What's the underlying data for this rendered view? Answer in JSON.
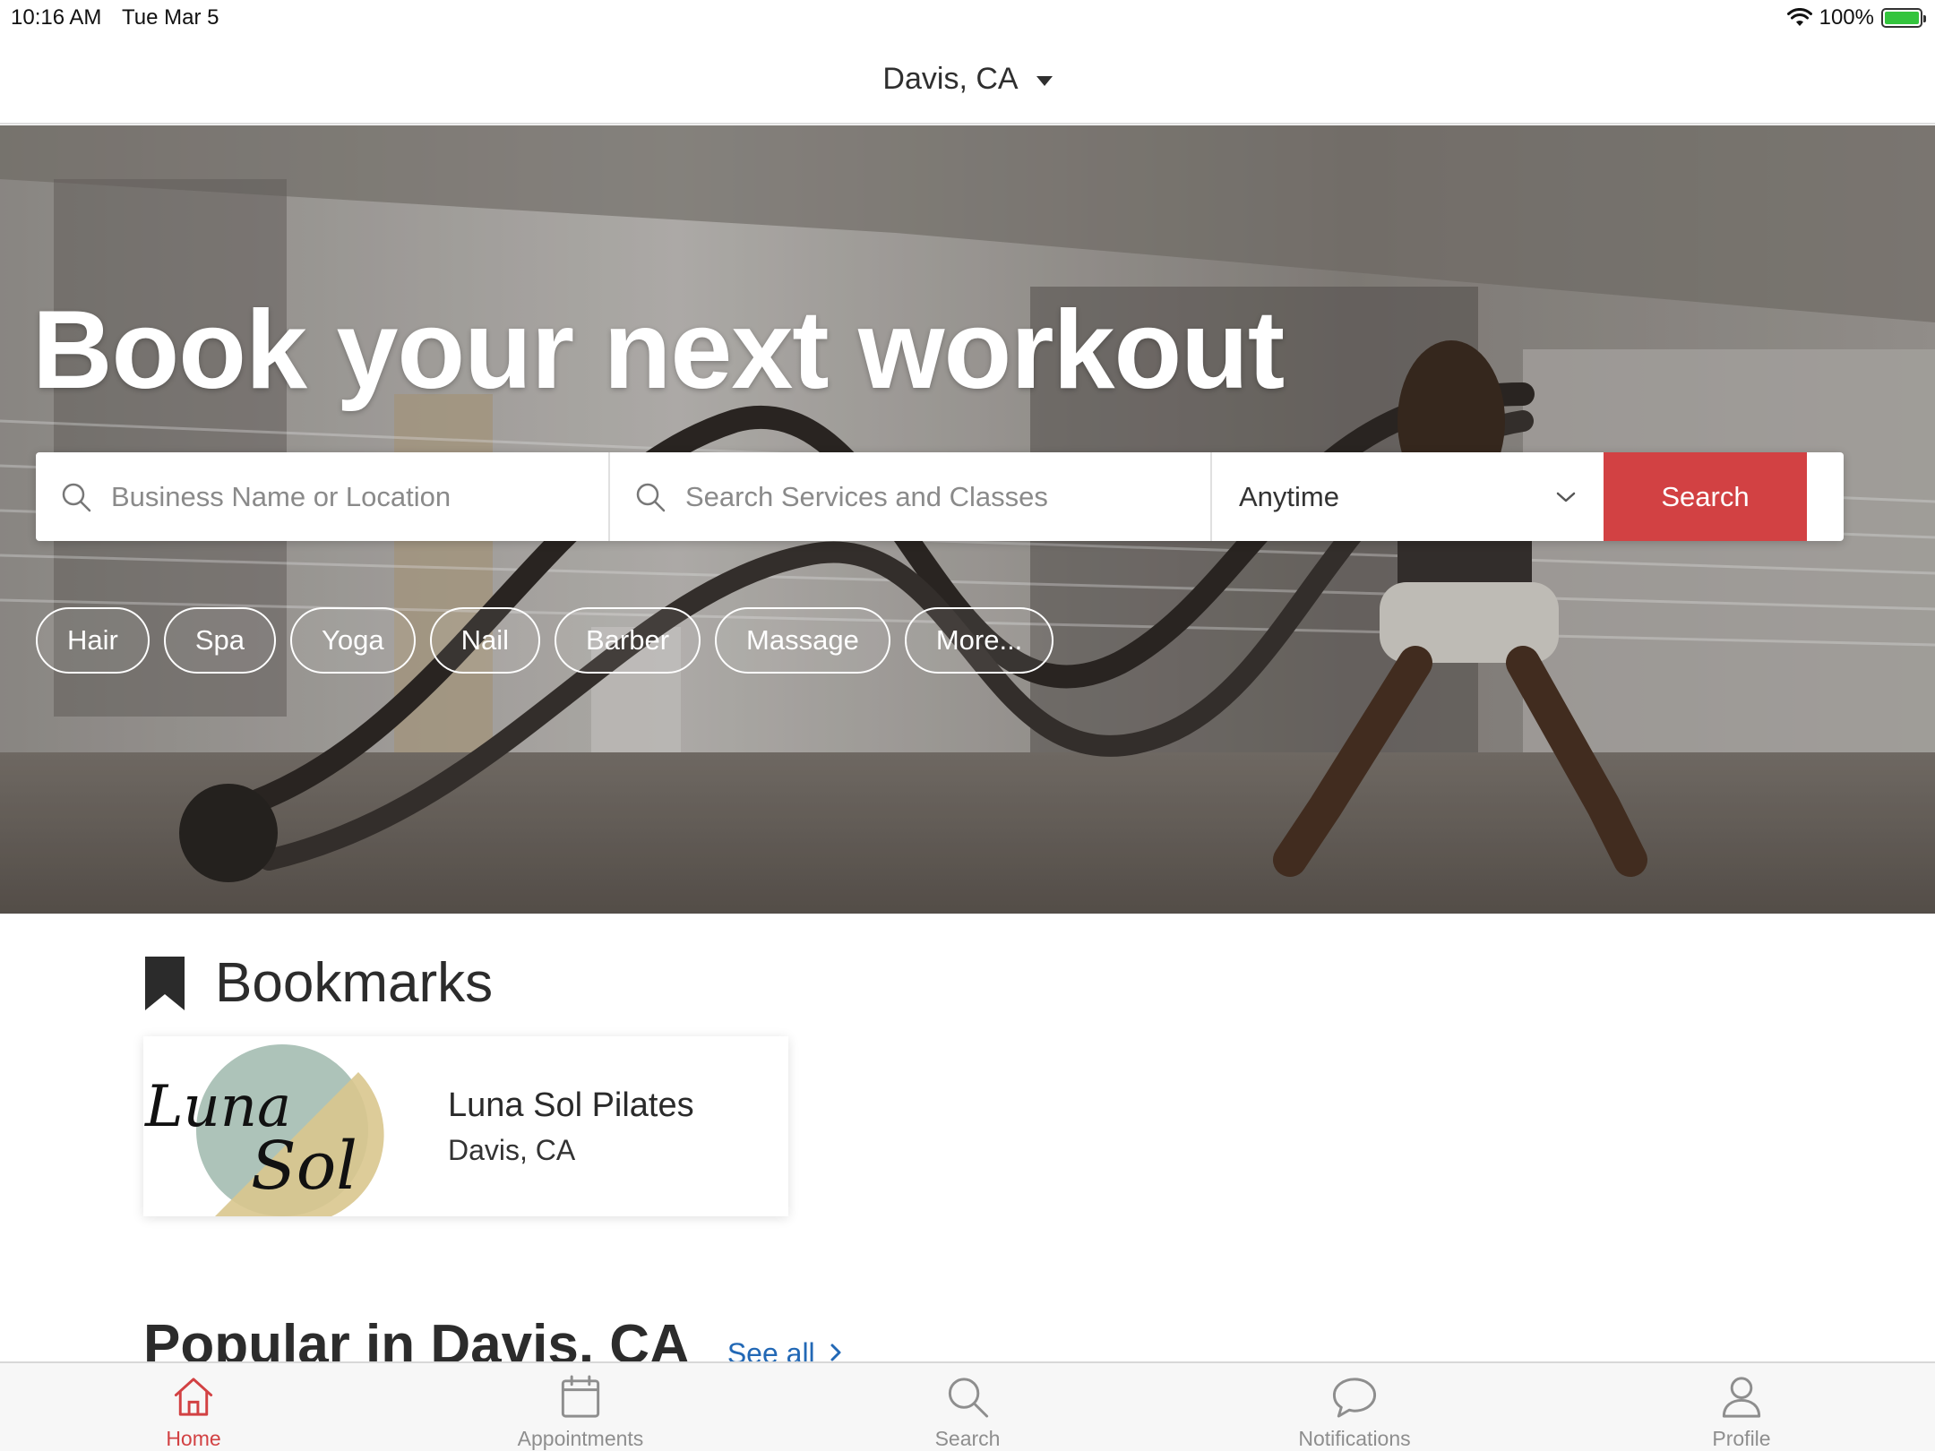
{
  "status_bar": {
    "time": "10:16 AM",
    "date": "Tue Mar 5",
    "battery": "100%"
  },
  "header": {
    "location": "Davis, CA"
  },
  "hero": {
    "title": "Book your next workout",
    "search": {
      "business_placeholder": "Business Name or Location",
      "services_placeholder": "Search Services and Classes",
      "when_value": "Anytime",
      "button_label": "Search"
    },
    "chips": [
      "Hair",
      "Spa",
      "Yoga",
      "Nail",
      "Barber",
      "Massage",
      "More..."
    ]
  },
  "bookmarks": {
    "title": "Bookmarks",
    "items": [
      {
        "name": "Luna Sol Pilates",
        "location": "Davis, CA",
        "logo_text": "Luna Sol"
      }
    ]
  },
  "popular": {
    "title": "Popular in Davis, CA",
    "see_all": "See all"
  },
  "tab_bar": {
    "items": [
      {
        "label": "Home",
        "icon": "home-icon",
        "active": true
      },
      {
        "label": "Appointments",
        "icon": "calendar-icon",
        "active": false
      },
      {
        "label": "Search",
        "icon": "search-icon",
        "active": false
      },
      {
        "label": "Notifications",
        "icon": "chat-bubble-icon",
        "active": false
      },
      {
        "label": "Profile",
        "icon": "person-icon",
        "active": false
      }
    ]
  },
  "colors": {
    "accent": "#d24143",
    "link": "#2268b5",
    "battery": "#33c43d"
  }
}
